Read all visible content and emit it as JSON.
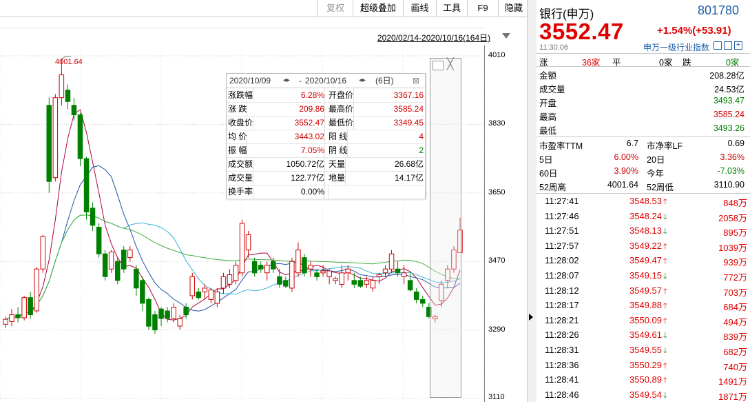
{
  "toolbar": {
    "buttons": [
      {
        "label": "复权",
        "disabled": true
      },
      {
        "label": "超级叠加"
      },
      {
        "label": "画线"
      },
      {
        "label": "工具"
      },
      {
        "label": "F9"
      },
      {
        "label": "隐藏"
      }
    ]
  },
  "chart": {
    "date_range": "2020/02/14-2020/10/16(164日)",
    "max_label": "4001.64",
    "price_ticks": [
      "4010",
      "3830",
      "3650",
      "3470",
      "3290",
      "3110"
    ]
  },
  "chart_data": {
    "type": "candlestick",
    "ylim": [
      3110,
      4010
    ],
    "price_ticks": [
      4010,
      3830,
      3650,
      3470,
      3290,
      3110
    ],
    "max_label": "4001.64",
    "ohlc": [
      [
        3305,
        3325,
        3295,
        3318
      ],
      [
        3312,
        3345,
        3300,
        3330
      ],
      [
        3330,
        3350,
        3310,
        3322
      ],
      [
        3322,
        3380,
        3315,
        3375
      ],
      [
        3375,
        3390,
        3320,
        3330
      ],
      [
        3340,
        3455,
        3335,
        3450
      ],
      [
        3450,
        3540,
        3440,
        3535
      ],
      [
        3880,
        3900,
        3650,
        3680
      ],
      [
        3690,
        3910,
        3680,
        3900
      ],
      [
        3900,
        4001.64,
        3880,
        3960
      ],
      [
        3920,
        3935,
        3870,
        3890
      ],
      [
        3880,
        3900,
        3840,
        3855
      ],
      [
        3855,
        3860,
        3720,
        3740
      ],
      [
        3740,
        3745,
        3580,
        3600
      ],
      [
        3610,
        3625,
        3550,
        3565
      ],
      [
        3560,
        3570,
        3480,
        3490
      ],
      [
        3490,
        3500,
        3420,
        3430
      ],
      [
        3450,
        3500,
        3440,
        3495
      ],
      [
        3470,
        3480,
        3410,
        3420
      ],
      [
        3500,
        3510,
        3440,
        3450
      ],
      [
        3480,
        3510,
        3470,
        3500
      ],
      [
        3450,
        3460,
        3380,
        3400
      ],
      [
        3420,
        3430,
        3340,
        3360
      ],
      [
        3370,
        3375,
        3290,
        3300
      ],
      [
        3330,
        3340,
        3280,
        3290
      ],
      [
        3345,
        3350,
        3300,
        3320
      ],
      [
        3340,
        3350,
        3310,
        3320
      ],
      [
        3320,
        3360,
        3310,
        3350
      ],
      [
        3300,
        3330,
        3290,
        3320
      ],
      [
        3350,
        3360,
        3320,
        3330
      ],
      [
        3380,
        3440,
        3370,
        3430
      ],
      [
        3390,
        3400,
        3370,
        3375
      ],
      [
        3390,
        3410,
        3370,
        3400
      ],
      [
        3370,
        3400,
        3360,
        3395
      ],
      [
        3360,
        3400,
        3350,
        3390
      ],
      [
        3400,
        3440,
        3385,
        3430
      ],
      [
        3410,
        3450,
        3400,
        3435
      ],
      [
        3420,
        3470,
        3410,
        3460
      ],
      [
        3440,
        3580,
        3430,
        3570
      ],
      [
        3500,
        3550,
        3480,
        3540
      ],
      [
        3470,
        3480,
        3430,
        3440
      ],
      [
        3460,
        3470,
        3440,
        3450
      ],
      [
        3440,
        3470,
        3420,
        3460
      ],
      [
        3470,
        3480,
        3440,
        3450
      ],
      [
        3430,
        3450,
        3400,
        3410
      ],
      [
        3420,
        3430,
        3400,
        3405
      ],
      [
        3400,
        3480,
        3390,
        3470
      ],
      [
        3440,
        3520,
        3430,
        3500
      ],
      [
        3480,
        3490,
        3430,
        3440
      ],
      [
        3450,
        3470,
        3430,
        3460
      ],
      [
        3440,
        3450,
        3420,
        3430
      ],
      [
        3440,
        3460,
        3430,
        3445
      ],
      [
        3430,
        3450,
        3410,
        3445
      ],
      [
        3420,
        3430,
        3410,
        3425
      ],
      [
        3410,
        3460,
        3400,
        3440
      ],
      [
        3440,
        3460,
        3420,
        3450
      ],
      [
        3420,
        3440,
        3400,
        3410
      ],
      [
        3420,
        3430,
        3400,
        3405
      ],
      [
        3410,
        3430,
        3400,
        3420
      ],
      [
        3400,
        3430,
        3390,
        3420
      ],
      [
        3430,
        3440,
        3410,
        3435
      ],
      [
        3440,
        3460,
        3430,
        3450
      ],
      [
        3450,
        3500,
        3440,
        3490
      ],
      [
        3450,
        3470,
        3430,
        3440
      ],
      [
        3430,
        3460,
        3410,
        3440
      ],
      [
        3420,
        3440,
        3390,
        3395
      ],
      [
        3390,
        3400,
        3360,
        3370
      ],
      [
        3370,
        3380,
        3350,
        3360
      ],
      [
        3350,
        3360,
        3320,
        3325
      ],
      [
        3320,
        3330,
        3310,
        3325
      ],
      [
        3367.16,
        3420,
        3349.45,
        3410
      ],
      [
        3420,
        3460,
        3400,
        3450
      ],
      [
        3450,
        3510,
        3440,
        3500
      ],
      [
        3493.47,
        3585.24,
        3493.26,
        3552.47
      ]
    ]
  },
  "popup": {
    "date_from": "2020/10/09",
    "date_to": "2020/10/16",
    "days": "(6日)",
    "rows": [
      {
        "l1": "涨跌幅",
        "v1": "6.28%",
        "c1": "red",
        "l2": "开盘价",
        "v2": "3367.16",
        "c2": "red"
      },
      {
        "l1": "涨  跌",
        "v1": "209.86",
        "c1": "red",
        "l2": "最高价",
        "v2": "3585.24",
        "c2": "red"
      },
      {
        "l1": "收盘价",
        "v1": "3552.47",
        "c1": "red",
        "l2": "最低价",
        "v2": "3349.45",
        "c2": "red"
      },
      {
        "l1": "均  价",
        "v1": "3443.02",
        "c1": "red",
        "l2": "阳  线",
        "v2": "4",
        "c2": "red"
      },
      {
        "l1": "振  幅",
        "v1": "7.05%",
        "c1": "red",
        "l2": "阴  线",
        "v2": "2",
        "c2": "green"
      },
      {
        "l1": "成交额",
        "v1": "1050.72亿",
        "c1": "black",
        "l2": "天量",
        "v2": "26.68亿",
        "c2": "black"
      },
      {
        "l1": "成交量",
        "v1": "122.77亿",
        "c1": "black",
        "l2": "地量",
        "v2": "14.17亿",
        "c2": "black"
      },
      {
        "l1": "换手率",
        "v1": "0.00%",
        "c1": "black",
        "l2": "",
        "v2": "",
        "c2": "black"
      }
    ]
  },
  "quote": {
    "name": "银行(申万)",
    "code": "801780",
    "price": "3552.47",
    "change": "+1.54%(+53.91)",
    "time": "11:30:06",
    "index_link": "申万一级行业指数",
    "breadth": {
      "up_label": "涨",
      "up": "36家",
      "flat_label": "平",
      "flat": "0家",
      "down_label": "跌",
      "down": "0家"
    },
    "fields1": [
      {
        "label": "金额",
        "value": "208.28亿",
        "color": "black"
      },
      {
        "label": "成交量",
        "value": "24.53亿",
        "color": "black"
      },
      {
        "label": "开盘",
        "value": "3493.47",
        "color": "green"
      },
      {
        "label": "最高",
        "value": "3585.24",
        "color": "red"
      },
      {
        "label": "最低",
        "value": "3493.26",
        "color": "green"
      }
    ],
    "fields2": [
      {
        "l1": "市盈率TTM",
        "v1": "6.7",
        "c1": "black",
        "l2": "市净率LF",
        "v2": "0.69",
        "c2": "black"
      },
      {
        "l1": "5日",
        "v1": "6.00%",
        "c1": "red",
        "l2": "20日",
        "v2": "3.36%",
        "c2": "red"
      },
      {
        "l1": "60日",
        "v1": "3.90%",
        "c1": "red",
        "l2": "今年",
        "v2": "-7.03%",
        "c2": "green"
      },
      {
        "l1": "52周高",
        "v1": "4001.64",
        "c1": "black",
        "l2": "52周低",
        "v2": "3110.90",
        "c2": "black"
      }
    ],
    "ticks": [
      {
        "time": "11:27:41",
        "price": "3548.53",
        "dir": "up",
        "vol": "848万"
      },
      {
        "time": "11:27:46",
        "price": "3548.24",
        "dir": "down",
        "vol": "2058万"
      },
      {
        "time": "11:27:51",
        "price": "3548.13",
        "dir": "down",
        "vol": "895万"
      },
      {
        "time": "11:27:57",
        "price": "3549.22",
        "dir": "up",
        "vol": "1039万"
      },
      {
        "time": "11:28:02",
        "price": "3549.47",
        "dir": "up",
        "vol": "939万"
      },
      {
        "time": "11:28:07",
        "price": "3549.15",
        "dir": "down",
        "vol": "772万"
      },
      {
        "time": "11:28:12",
        "price": "3549.57",
        "dir": "up",
        "vol": "703万"
      },
      {
        "time": "11:28:17",
        "price": "3549.88",
        "dir": "up",
        "vol": "684万"
      },
      {
        "time": "11:28:21",
        "price": "3550.09",
        "dir": "up",
        "vol": "494万"
      },
      {
        "time": "11:28:26",
        "price": "3549.61",
        "dir": "down",
        "vol": "839万"
      },
      {
        "time": "11:28:31",
        "price": "3549.55",
        "dir": "down",
        "vol": "682万"
      },
      {
        "time": "11:28:36",
        "price": "3550.29",
        "dir": "up",
        "vol": "740万"
      },
      {
        "time": "11:28:41",
        "price": "3550.89",
        "dir": "up",
        "vol": "1491万"
      },
      {
        "time": "11:28:46",
        "price": "3549.54",
        "dir": "down",
        "vol": "1871万"
      }
    ],
    "colors": {
      "red": "#e00000",
      "green": "#008000",
      "blue": "#1f5fa8"
    }
  }
}
